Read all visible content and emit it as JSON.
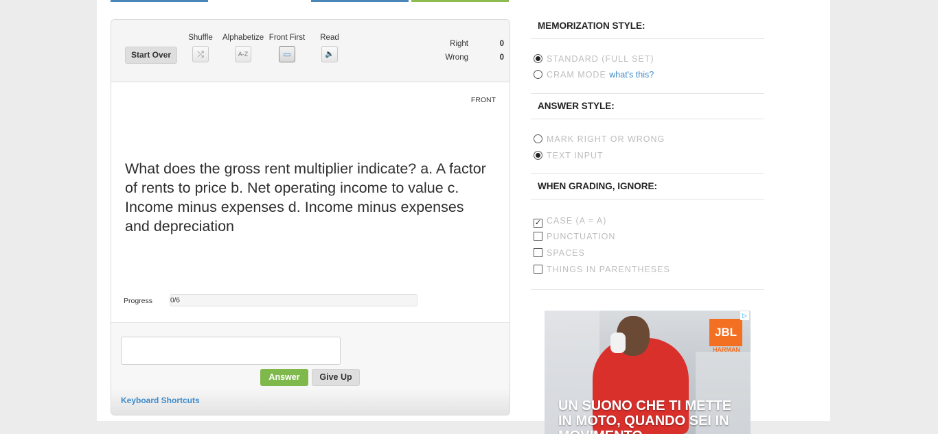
{
  "tabs": [
    {
      "color": "#4a86b8"
    },
    {
      "color": "#ffffff"
    },
    {
      "color": "#4a86b8"
    },
    {
      "color": "#8dbb4f"
    }
  ],
  "toolbar": {
    "start_over": "Start Over",
    "tools": [
      {
        "label": "Shuffle",
        "icon": "shuffle-icon",
        "glyph": "⤮"
      },
      {
        "label": "Alphabetize",
        "icon": "alphabetize-icon",
        "glyph": "A-Z"
      },
      {
        "label": "Front First",
        "icon": "monitor-icon",
        "glyph": "▭"
      },
      {
        "label": "Read",
        "icon": "speaker-icon",
        "glyph": "🔈"
      }
    ]
  },
  "score": {
    "right_label": "Right",
    "right_value": "0",
    "wrong_label": "Wrong",
    "wrong_value": "0"
  },
  "card": {
    "side": "FRONT",
    "question": "What does the gross rent multiplier indicate? a. A factor of rents to price b. Net operating income to value c. Income minus expenses d. Income minus expenses and depreciation"
  },
  "progress": {
    "label": "Progress",
    "text": "0/6",
    "fraction": 0
  },
  "answer": {
    "input_value": "",
    "answer_label": "Answer",
    "give_up_label": "Give Up",
    "keyboard_shortcuts": "Keyboard Shortcuts"
  },
  "settings": {
    "memorization": {
      "title": "MEMORIZATION STYLE:",
      "standard": "STANDARD (FULL SET)",
      "cram": "CRAM MODE",
      "cram_link": "what's this?"
    },
    "answer_style": {
      "title": "ANSWER STYLE:",
      "mark": "MARK RIGHT OR WRONG",
      "text": "TEXT INPUT"
    },
    "ignore": {
      "title": "WHEN GRADING, IGNORE:",
      "case": "CASE (A = A)",
      "punctuation": "PUNCTUATION",
      "spaces": "SPACES",
      "parentheses": "THINGS IN PARENTHESES"
    }
  },
  "ad": {
    "brand": "JBL",
    "maker": "HARMAN",
    "headline": "UN SUONO CHE TI METTE IN MOTO, QUANDO SEI IN MOVIMENTO"
  },
  "colors": {
    "accent_blue": "#3e8ac9",
    "answer_green": "#7fb94c",
    "jbl_orange": "#f36f21"
  }
}
